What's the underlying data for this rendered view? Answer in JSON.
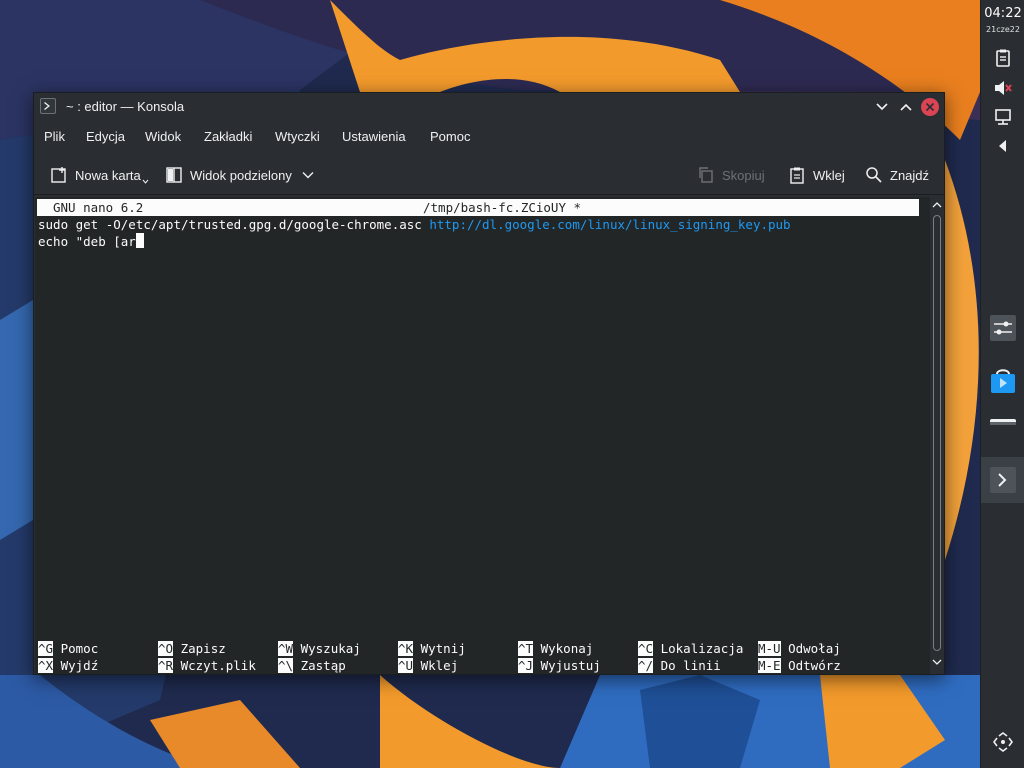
{
  "panel": {
    "clock_time": "04:22",
    "clock_date": "21cze22",
    "tray_icons": [
      "clipboard-icon",
      "volume-muted-icon",
      "network-icon",
      "expand-tray-icon"
    ],
    "task_icons": [
      "system-settings-icon",
      "discover-store-icon",
      "file-manager-icon",
      "konsole-icon",
      "move-panel-icon"
    ]
  },
  "window": {
    "title": "~ : editor — Konsola",
    "menu": [
      "Plik",
      "Edycja",
      "Widok",
      "Zakładki",
      "Wtyczki",
      "Ustawienia",
      "Pomoc"
    ],
    "toolbar": {
      "new_tab": "Nowa karta",
      "split_view": "Widok podzielony",
      "copy": "Skopiuj",
      "paste": "Wklej",
      "find": "Znajdź"
    }
  },
  "terminal": {
    "header_version": "GNU nano 6.2",
    "header_file": "/tmp/bash-fc.ZCioUY *",
    "line1_text": "sudo get -O/etc/apt/trusted.gpg.d/google-chrome.asc ",
    "line1_url": "http://dl.google.com/linux/linux_signing_key.pub",
    "line2_text": "echo \"deb [ar",
    "shortcuts_row1": [
      {
        "key": "^G",
        "label": "Pomoc"
      },
      {
        "key": "^O",
        "label": "Zapisz"
      },
      {
        "key": "^W",
        "label": "Wyszukaj"
      },
      {
        "key": "^K",
        "label": "Wytnij"
      },
      {
        "key": "^T",
        "label": "Wykonaj"
      },
      {
        "key": "^C",
        "label": "Lokalizacja"
      },
      {
        "key": "M-U",
        "label": "Odwołaj"
      }
    ],
    "shortcuts_row2": [
      {
        "key": "^X",
        "label": "Wyjdź"
      },
      {
        "key": "^R",
        "label": "Wczyt.plik"
      },
      {
        "key": "^\\",
        "label": "Zastąp"
      },
      {
        "key": "^U",
        "label": "Wklej"
      },
      {
        "key": "^J",
        "label": "Wyjustuj"
      },
      {
        "key": "^/",
        "label": "Do linii"
      },
      {
        "key": "M-E",
        "label": "Odtwórz"
      }
    ]
  },
  "colors": {
    "accent": "#1d99f3",
    "close_button": "#da4453",
    "window_bg": "#2a2e32",
    "terminal_bg": "#232627"
  }
}
